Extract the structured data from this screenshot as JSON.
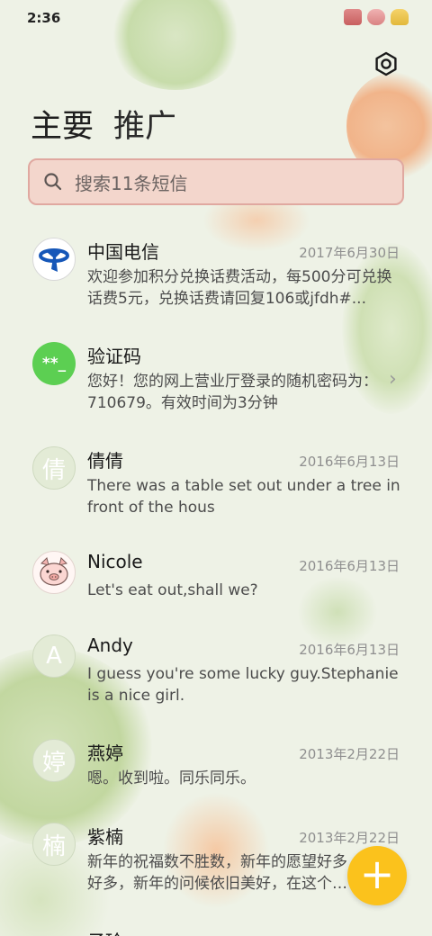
{
  "status_bar": {
    "time": "2:36"
  },
  "header": {
    "tabs": [
      "主要",
      "推广"
    ]
  },
  "search": {
    "placeholder": "搜索11条短信"
  },
  "messages": [
    {
      "name": "中国电信",
      "date": "2017年6月30日",
      "preview": "欢迎参加积分兑换话费活动，每500分可兑换话费5元，兑换话费请回复106或jfdh#...",
      "avatar": "telecom"
    },
    {
      "name": "验证码",
      "date": "",
      "preview": "您好！您的网上营业厅登录的随机密码为：710679。有效时间为3分钟",
      "avatar_text": "**_"
    },
    {
      "name": "倩倩",
      "date": "2016年6月13日",
      "preview": "There was a table set out under a tree in front of the hous",
      "avatar_text": "倩"
    },
    {
      "name": "Nicole",
      "date": "2016年6月13日",
      "preview": "Let's eat out,shall we?",
      "avatar": "pig"
    },
    {
      "name": "Andy",
      "date": "2016年6月13日",
      "preview": "I guess you're some lucky guy.Stephanie is a nice girl.",
      "avatar_text": "A"
    },
    {
      "name": "燕婷",
      "date": "2013年2月22日",
      "preview": "嗯。收到啦。同乐同乐。",
      "avatar_text": "婷"
    },
    {
      "name": "紫楠",
      "date": "2013年2月22日",
      "preview": "新年的祝福数不胜数，新年的愿望好多好多，新年的问候依旧美好，在这个温馨的时刻",
      "avatar_text": "楠"
    },
    {
      "name": "子玲",
      "date": "",
      "preview": "",
      "avatar_text": ""
    }
  ],
  "fab": {
    "label": "+"
  }
}
